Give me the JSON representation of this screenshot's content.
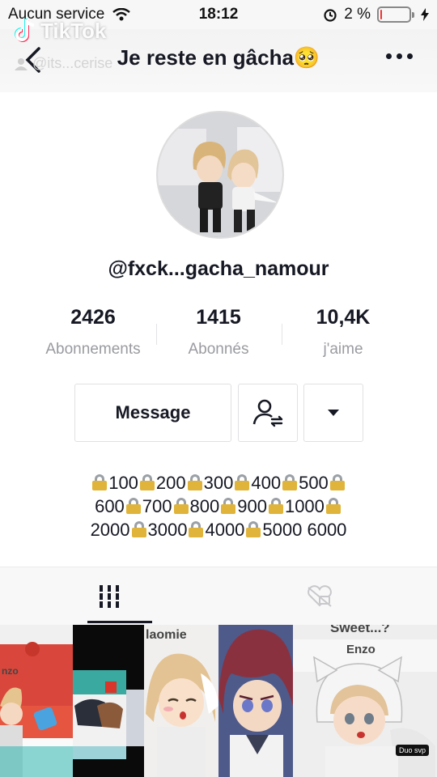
{
  "status_bar": {
    "carrier": "Aucun service",
    "time": "18:12",
    "battery_percent": "2 %",
    "battery_level": 0.02,
    "icons": [
      "wifi-icon",
      "alarm-icon",
      "battery-icon",
      "charging-icon"
    ]
  },
  "watermark": {
    "app_name": "TikTok",
    "user": "@its...cerise"
  },
  "header": {
    "title": "Je reste en gâcha🥺",
    "back_icon": "chevron-left-icon",
    "more_icon": "more-horizontal-icon"
  },
  "profile": {
    "username": "@fxck...gacha_namour"
  },
  "stats": [
    {
      "value": "2426",
      "label": "Abonnements"
    },
    {
      "value": "1415",
      "label": "Abonnés"
    },
    {
      "value": "10,4K",
      "label": "j'aime"
    }
  ],
  "actions": {
    "message_label": "Message",
    "follow_icon": "user-follow-icon",
    "dropdown_icon": "caret-down-icon"
  },
  "bio": {
    "lines": [
      [
        "100",
        "200",
        "300",
        "400",
        "500"
      ],
      [
        "600",
        "700",
        "800",
        "900",
        "1000"
      ],
      [
        "2000",
        "3000",
        "4000",
        "5000 6000"
      ]
    ]
  },
  "tabs": [
    {
      "icon": "grid-icon",
      "active": true
    },
    {
      "icon": "liked-hidden-icon",
      "active": false
    }
  ],
  "videos": [
    {
      "caption": "nzo"
    },
    {
      "caption": ""
    },
    {
      "caption": "laomie"
    },
    {
      "caption": ""
    },
    {
      "caption": "Sweet...?"
    }
  ],
  "videos_extra": {
    "tile5_label": "Enzo",
    "tile5_badge": "Duo svp"
  },
  "colors": {
    "text": "#161823",
    "muted": "#9a9ba0",
    "border": "#e1e1e3",
    "lock_gold": "#e0b43a"
  }
}
